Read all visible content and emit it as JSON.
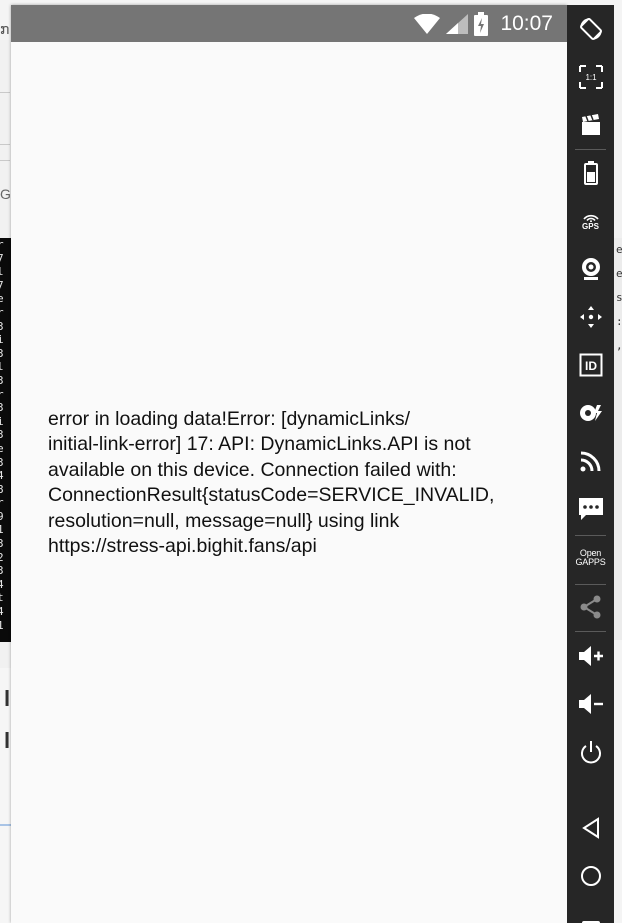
{
  "status_bar": {
    "time": "10:07",
    "icons": [
      "wifi-icon",
      "cell-signal-icon",
      "battery-charging-icon"
    ],
    "background": "#757575"
  },
  "app": {
    "error_message": "error in loading data!Error: [dynamicLinks/\ninitial-link-error] 17: API: DynamicLinks.API is not\navailable on this device. Connection failed with:\nConnectionResult{statusCode=SERVICE_INVALID,\nresolution=null, message=null} using link\nhttps://stress-api.bighit.fans/api"
  },
  "emulator_toolbar": {
    "background": "#262626",
    "buttons": [
      {
        "name": "rotate-icon"
      },
      {
        "name": "pixel-perfect-icon",
        "label": "1:1"
      },
      {
        "name": "screen-record-icon"
      },
      {
        "name": "battery-icon"
      },
      {
        "name": "gps-icon",
        "label": "GPS"
      },
      {
        "name": "camera-icon"
      },
      {
        "name": "remote-control-icon"
      },
      {
        "name": "identifiers-icon",
        "label": "ID"
      },
      {
        "name": "nfc-icon"
      },
      {
        "name": "network-icon"
      },
      {
        "name": "sms-icon"
      },
      {
        "name": "open-gapps-icon",
        "label": "Open GAPPS"
      },
      {
        "name": "share-icon"
      },
      {
        "name": "volume-up-icon"
      },
      {
        "name": "volume-down-icon"
      },
      {
        "name": "power-icon"
      },
      {
        "name": "back-icon"
      },
      {
        "name": "home-icon"
      },
      {
        "name": "recent-apps-icon"
      }
    ]
  },
  "background_window": {
    "terminal_left_chars": [
      "r",
      "7",
      "l",
      "7",
      "e",
      "r",
      "3",
      "i",
      "3",
      "l",
      "3",
      "r",
      "3",
      "i",
      "3",
      "e",
      "3",
      "4",
      "8",
      "r",
      "9",
      "1",
      "3",
      "2",
      "3",
      "4",
      "t",
      "4",
      "1"
    ],
    "terminal_right_chars": [
      "e",
      "e",
      "s",
      ":",
      ","
    ]
  }
}
